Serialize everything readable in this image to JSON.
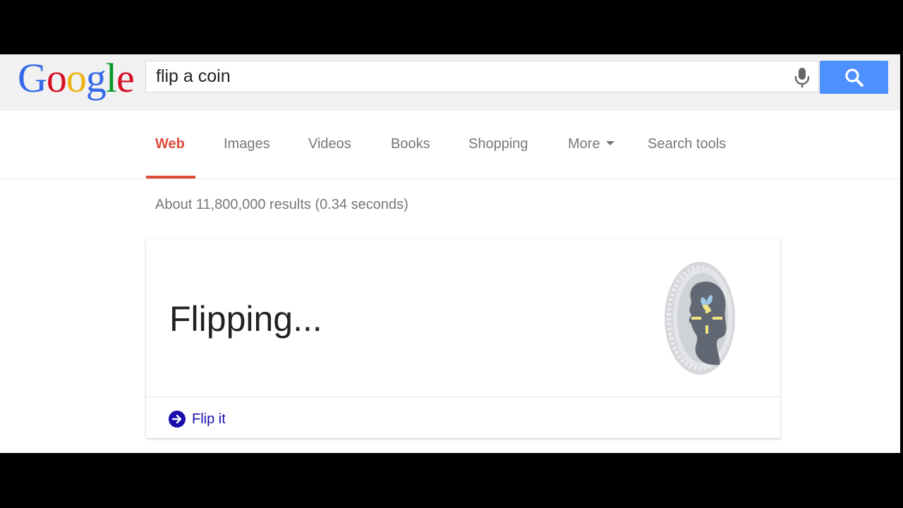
{
  "logo": {
    "letters": [
      "G",
      "o",
      "o",
      "g",
      "l",
      "e"
    ],
    "colors": [
      "#3369e8",
      "#d50f25",
      "#eeb211",
      "#3369e8",
      "#009925",
      "#d50f25"
    ]
  },
  "search": {
    "query": "flip a coin",
    "button_color": "#4d90fe"
  },
  "tabs": [
    {
      "label": "Web",
      "active": true
    },
    {
      "label": "Images"
    },
    {
      "label": "Videos"
    },
    {
      "label": "Books"
    },
    {
      "label": "Shopping"
    },
    {
      "label": "More"
    },
    {
      "label": "Search tools"
    }
  ],
  "result_stats": "About 11,800,000 results (0.34 seconds)",
  "coin_card": {
    "status_text": "Flipping...",
    "action_label": "Flip it",
    "action_icon": "arrow-circle-right-icon"
  },
  "colors": {
    "active_tab": "#dd4b39",
    "link": "#1a0dab",
    "muted_text": "#777777"
  }
}
